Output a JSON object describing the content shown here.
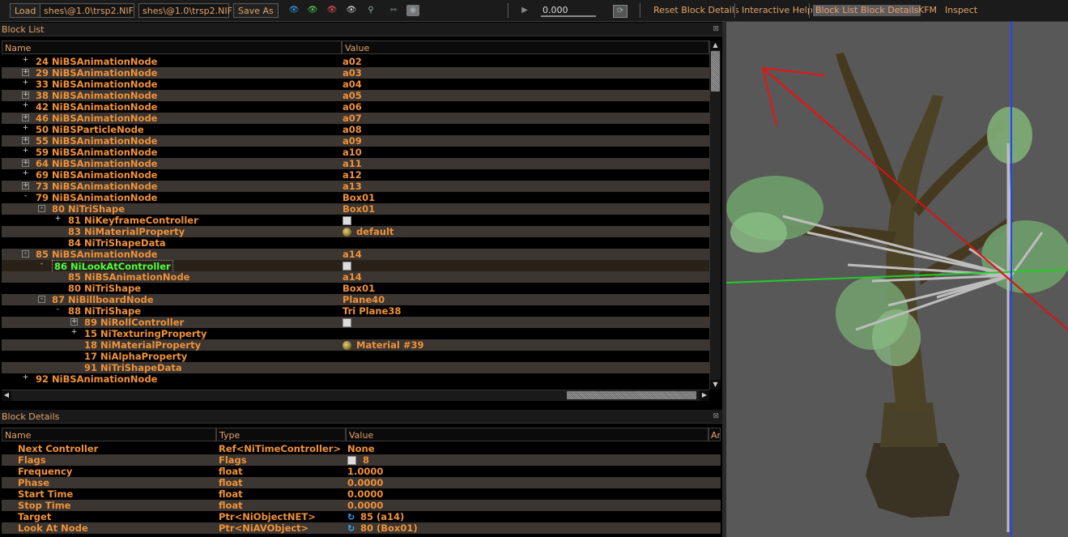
{
  "toolbar": {
    "load_label": "Load",
    "load_path": "shes\\@1.0\\trsp2.NIF",
    "save_path": "shes\\@1.0\\trsp2.NIF",
    "save_as_label": "Save As",
    "time_value": "0.000",
    "reset_block_details": "Reset Block Details",
    "interactive_help": "Interactive Help",
    "block_list": "Block List",
    "block_details": "Block Details",
    "kfm": "KFM",
    "inspect": "Inspect"
  },
  "block_list": {
    "title": "Block List",
    "columns": [
      "Name",
      "Value"
    ],
    "rows": [
      {
        "name": "24 NiBSAnimationNode",
        "value": "a02",
        "depth": 0,
        "ctl": "+"
      },
      {
        "name": "29 NiBSAnimationNode",
        "value": "a03",
        "depth": 0,
        "ctl": "box+"
      },
      {
        "name": "33 NiBSAnimationNode",
        "value": "a04",
        "depth": 0,
        "ctl": "+"
      },
      {
        "name": "38 NiBSAnimationNode",
        "value": "a05",
        "depth": 0,
        "ctl": "box+"
      },
      {
        "name": "42 NiBSAnimationNode",
        "value": "a06",
        "depth": 0,
        "ctl": "+"
      },
      {
        "name": "46 NiBSAnimationNode",
        "value": "a07",
        "depth": 0,
        "ctl": "box+"
      },
      {
        "name": "50 NiBSParticleNode",
        "value": "a08",
        "depth": 0,
        "ctl": "+"
      },
      {
        "name": "55 NiBSAnimationNode",
        "value": "a09",
        "depth": 0,
        "ctl": "box+"
      },
      {
        "name": "59 NiBSAnimationNode",
        "value": "a10",
        "depth": 0,
        "ctl": "+"
      },
      {
        "name": "64 NiBSAnimationNode",
        "value": "a11",
        "depth": 0,
        "ctl": "box+"
      },
      {
        "name": "69 NiBSAnimationNode",
        "value": "a12",
        "depth": 0,
        "ctl": "+"
      },
      {
        "name": "73 NiBSAnimationNode",
        "value": "a13",
        "depth": 0,
        "ctl": "box+"
      },
      {
        "name": "79 NiBSAnimationNode",
        "value": "Box01",
        "depth": 0,
        "ctl": "-"
      },
      {
        "name": "80 NiTriShape",
        "value": "Box01",
        "depth": 1,
        "ctl": "box-"
      },
      {
        "name": "81 NiKeyframeController",
        "value": "",
        "depth": 2,
        "ctl": "+",
        "icon": "flag"
      },
      {
        "name": "83 NiMaterialProperty",
        "value": "default",
        "depth": 2,
        "ctl": "",
        "icon": "palette"
      },
      {
        "name": "84 NiTriShapeData",
        "value": "",
        "depth": 2,
        "ctl": ""
      },
      {
        "name": "85 NiBSAnimationNode",
        "value": "a14",
        "depth": 0,
        "ctl": "box-"
      },
      {
        "name": "86 NiLookAtController",
        "value": "",
        "depth": 1,
        "ctl": "-",
        "icon": "flag",
        "selected": true
      },
      {
        "name": "85 NiBSAnimationNode",
        "value": "a14",
        "depth": 2,
        "ctl": ""
      },
      {
        "name": "80 NiTriShape",
        "value": "Box01",
        "depth": 2,
        "ctl": ""
      },
      {
        "name": "87 NiBillboardNode",
        "value": "Plane40",
        "depth": 1,
        "ctl": "box-"
      },
      {
        "name": "88 NiTriShape",
        "value": "Tri Plane38",
        "depth": 2,
        "ctl": "-"
      },
      {
        "name": "89 NiRollController",
        "value": "",
        "depth": 3,
        "ctl": "box+",
        "icon": "flag"
      },
      {
        "name": "15 NiTexturingProperty",
        "value": "",
        "depth": 3,
        "ctl": "+"
      },
      {
        "name": "18 NiMaterialProperty",
        "value": "Material #39",
        "depth": 3,
        "ctl": "",
        "icon": "palette"
      },
      {
        "name": "17 NiAlphaProperty",
        "value": "",
        "depth": 3,
        "ctl": ""
      },
      {
        "name": "91 NiTriShapeData",
        "value": "",
        "depth": 3,
        "ctl": ""
      },
      {
        "name": "92 NiBSAnimationNode",
        "value": "",
        "depth": 0,
        "ctl": "+"
      }
    ]
  },
  "block_details": {
    "title": "Block Details",
    "columns": [
      "Name",
      "Type",
      "Value",
      "An"
    ],
    "rows": [
      {
        "name": "Next Controller",
        "type": "Ref<NiTimeController>",
        "value": "None",
        "icon": ""
      },
      {
        "name": "Flags",
        "type": "Flags",
        "value": "8",
        "icon": "flag"
      },
      {
        "name": "Frequency",
        "type": "float",
        "value": "1.0000",
        "icon": ""
      },
      {
        "name": "Phase",
        "type": "float",
        "value": "0.0000",
        "icon": ""
      },
      {
        "name": "Start Time",
        "type": "float",
        "value": "0.0000",
        "icon": ""
      },
      {
        "name": "Stop Time",
        "type": "float",
        "value": "0.0000",
        "icon": ""
      },
      {
        "name": "Target",
        "type": "Ptr<NiObjectNET>",
        "value": "85 (a14)",
        "icon": "link"
      },
      {
        "name": "Look At Node",
        "type": "Ptr<NiAVObject>",
        "value": "80 (Box01)",
        "icon": "link"
      }
    ]
  },
  "colors": {
    "accent": "#f0923a",
    "selected_text": "#4cff3c",
    "alt_row": "#3b3631",
    "viewport_bg": "#585858"
  }
}
